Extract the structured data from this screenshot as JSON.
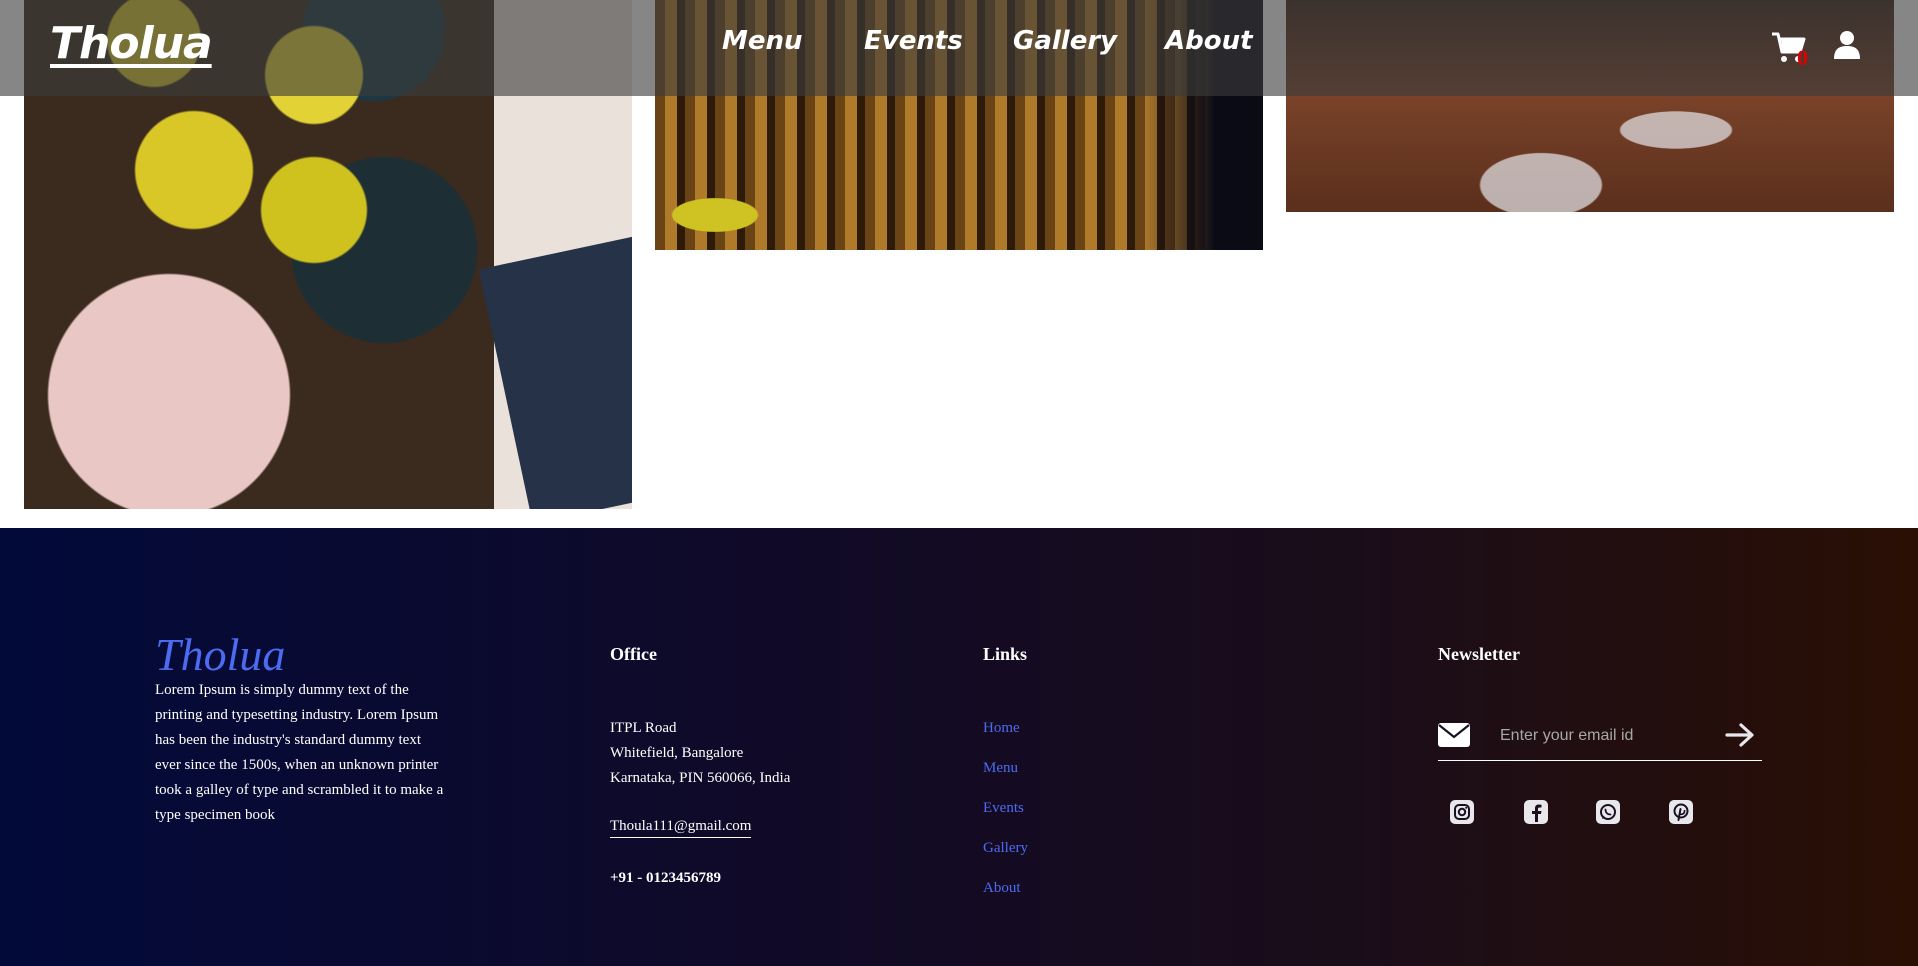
{
  "header": {
    "logo": "Tholua",
    "nav": [
      "Menu",
      "Events",
      "Gallery",
      "About"
    ],
    "cart_count": "0",
    "icons": [
      "cart-icon",
      "user-icon"
    ]
  },
  "gallery": {
    "photos": [
      "drinks-table-photo",
      "wood-slat-wall-photo",
      "wine-glasses-photo"
    ]
  },
  "footer": {
    "brand": "Tholua",
    "description": "Lorem Ipsum is simply dummy text of the printing and typesetting industry. Lorem Ipsum has been the industry's standard dummy text ever since the 1500s, when an unknown printer took a galley of type and scrambled it to make a type specimen book",
    "office": {
      "title": "Office",
      "address": [
        "ITPL Road",
        "Whitefield, Bangalore",
        "Karnataka, PIN 560066, India"
      ],
      "email": "Thoula111@gmail.com",
      "phone": "+91 - 0123456789"
    },
    "links": {
      "title": "Links",
      "items": [
        "Home",
        "Menu",
        "Events",
        "Gallery",
        "About"
      ]
    },
    "newsletter": {
      "title": "Newsletter",
      "placeholder": "Enter your email id",
      "icons": [
        "mail-icon",
        "arrow-right-icon"
      ]
    },
    "socials": [
      "instagram-icon",
      "facebook-icon",
      "whatsapp-icon",
      "pinterest-icon"
    ]
  },
  "colors": {
    "accent": "#4d6bf0",
    "cart_badge": "#e10000",
    "footer_start": "#020a3a",
    "footer_end": "#2a0f04"
  }
}
